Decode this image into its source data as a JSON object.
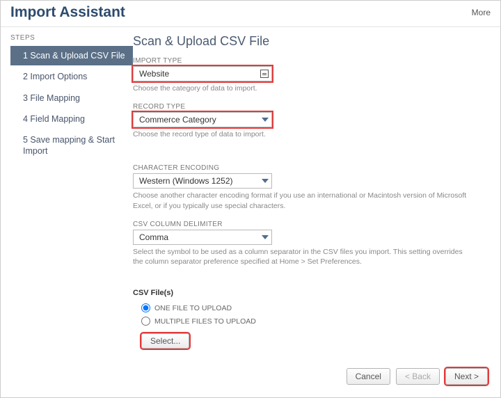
{
  "header": {
    "title": "Import Assistant",
    "more": "More"
  },
  "steps": {
    "heading": "STEPS",
    "items": [
      {
        "label": "1 Scan & Upload CSV File",
        "active": true
      },
      {
        "label": "2 Import Options",
        "active": false
      },
      {
        "label": "3 File Mapping",
        "active": false
      },
      {
        "label": "4 Field Mapping",
        "active": false
      },
      {
        "label": "5 Save mapping & Start Import",
        "active": false
      }
    ]
  },
  "main": {
    "title": "Scan & Upload CSV File",
    "import_type": {
      "label": "IMPORT TYPE",
      "value": "Website",
      "helper": "Choose the category of data to import."
    },
    "record_type": {
      "label": "RECORD TYPE",
      "value": "Commerce Category",
      "helper": "Choose the record type of data to import."
    },
    "char_encoding": {
      "label": "CHARACTER ENCODING",
      "value": "Western (Windows 1252)",
      "helper": "Choose another character encoding format if you use an international or Macintosh version of Microsoft Excel, or if you typically use special characters."
    },
    "delimiter": {
      "label": "CSV COLUMN DELIMITER",
      "value": "Comma",
      "helper": "Select the symbol to be used as a column separator in the CSV files you import. This setting overrides the column separator preference specified at Home > Set Preferences."
    },
    "csv_section": {
      "title": "CSV File(s)",
      "option_one": "ONE FILE TO UPLOAD",
      "option_multi": "MULTIPLE FILES TO UPLOAD",
      "select_btn": "Select..."
    }
  },
  "footer": {
    "cancel": "Cancel",
    "back": "< Back",
    "next": "Next >"
  }
}
